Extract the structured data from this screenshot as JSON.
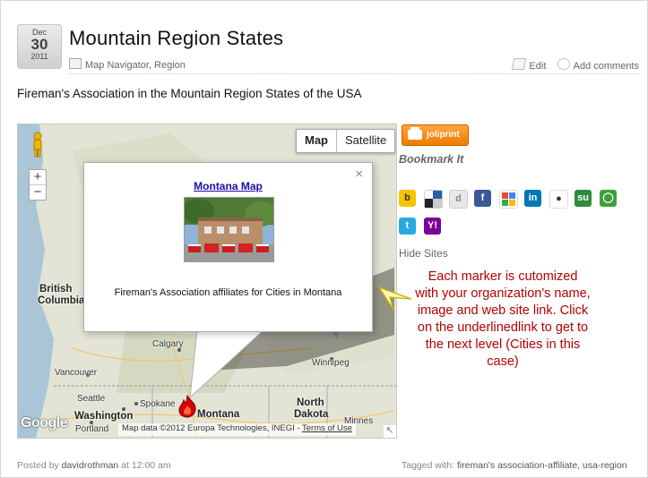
{
  "post": {
    "date": {
      "month": "Dec",
      "day": "30",
      "year": "2011"
    },
    "title": "Mountain Region States",
    "categories": "Map Navigator, Region",
    "edit_label": "Edit",
    "comments_label": "Add comments",
    "intro": "Fireman's Association in the Mountain Region States of the USA"
  },
  "map": {
    "type_buttons": [
      "Map",
      "Satellite"
    ],
    "active_type": "Map",
    "zoom_in": "+",
    "zoom_out": "−",
    "labels": {
      "british_columbia_1": "British",
      "british_columbia_2": "Columbia",
      "calgary": "Calgary",
      "vancouver": "Vancouver",
      "winnipeg": "Winnipeg",
      "seattle": "Seattle",
      "spokane": "Spokane",
      "washington": "Washington",
      "montana": "Montana",
      "north_dakota_1": "North",
      "north_dakota_2": "Dakota",
      "portland": "Portland",
      "minnesota": "Minnes"
    },
    "infowindow": {
      "link": "Montana Map",
      "caption": "Fireman's Association affiliates for Cities in Montana",
      "close": "×"
    },
    "google_logo": "Google",
    "attribution": "Map data ©2012 Europa Technologies, INEGI -",
    "terms": "Terms of Use"
  },
  "sidebar": {
    "print_label": "joliprint",
    "bookmark_title": "Bookmark It",
    "share_icons": [
      "blinklist-icon",
      "delicious-icon",
      "digg-icon",
      "facebook-icon",
      "google-icon",
      "linkedin-icon",
      "reddit-icon",
      "stumbleupon-icon",
      "technorati-icon",
      "twitter-icon",
      "yahoo-icon"
    ],
    "hide_sites": "Hide Sites",
    "callout": "Each marker is cutomized with your organization's name, image and web site link. Click on the underlinedlink to get to the next level (Cities in this case)"
  },
  "footer": {
    "posted_by": "Posted by",
    "author": "davidrothman",
    "time": "at 12:00 am",
    "tagged_with": "Tagged with:",
    "tags": "fireman's association-affiliate, usa-region"
  },
  "colors": {
    "callout_text": "#b40000",
    "link": "#1a0dab",
    "print_button": "#f07a00"
  }
}
